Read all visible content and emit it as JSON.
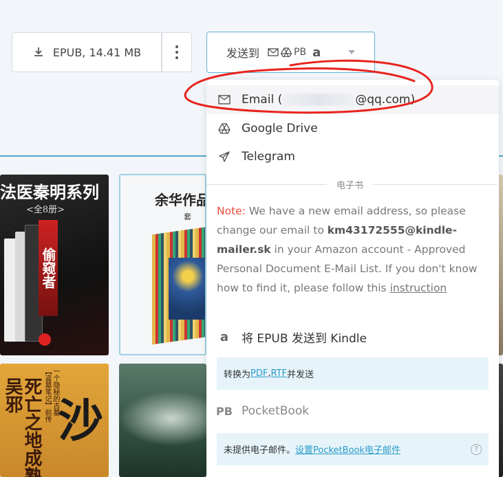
{
  "download": {
    "label": "EPUB, 14.41 MB"
  },
  "send_to": {
    "label": "发送到",
    "services": {
      "pb": "PB",
      "amazon": "a"
    }
  },
  "menu": {
    "email": {
      "prefix": "Email (",
      "suffix": "@qq.com)"
    },
    "gdrive": {
      "label": "Google Drive"
    },
    "telegram": {
      "label": "Telegram"
    },
    "section_label": "电子书",
    "note": {
      "prefix": "Note:",
      "text1": " We have a new email address, so please change our email to ",
      "address": "km43172555@kindle-mailer.sk",
      "text2": " in your Amazon account - Approved Personal Document E-Mail List. If you don't know how to find it, please follow this ",
      "link": "instruction"
    },
    "kindle": {
      "label": "将 EPUB 发送到 Kindle"
    },
    "convert": {
      "prefix": "转换为 ",
      "pdf": "PDF",
      "sep": ", ",
      "rtf": "RTF",
      "suffix": " 并发送"
    },
    "pocketbook": {
      "label": "PocketBook"
    },
    "pb_info": {
      "text": "未提供电子邮件。",
      "link": "设置PocketBook电子邮件",
      "help": "?"
    }
  },
  "books": {
    "b1": {
      "title": "法医秦明系列",
      "subtitle": "<全8册>",
      "red": "偷窥者"
    },
    "b2": {
      "title": "余华作品",
      "subtitle": "套"
    },
    "b3": {
      "big": "沙",
      "v1": "死亡之地成熟吴邪",
      "v2": "【盗墓笔记】前传",
      "v3": "一个隐秘的古墓"
    }
  },
  "colors": {
    "accent": "#4ba9c9",
    "scribble": "#e8231d",
    "note_red": "#e74c3c"
  }
}
